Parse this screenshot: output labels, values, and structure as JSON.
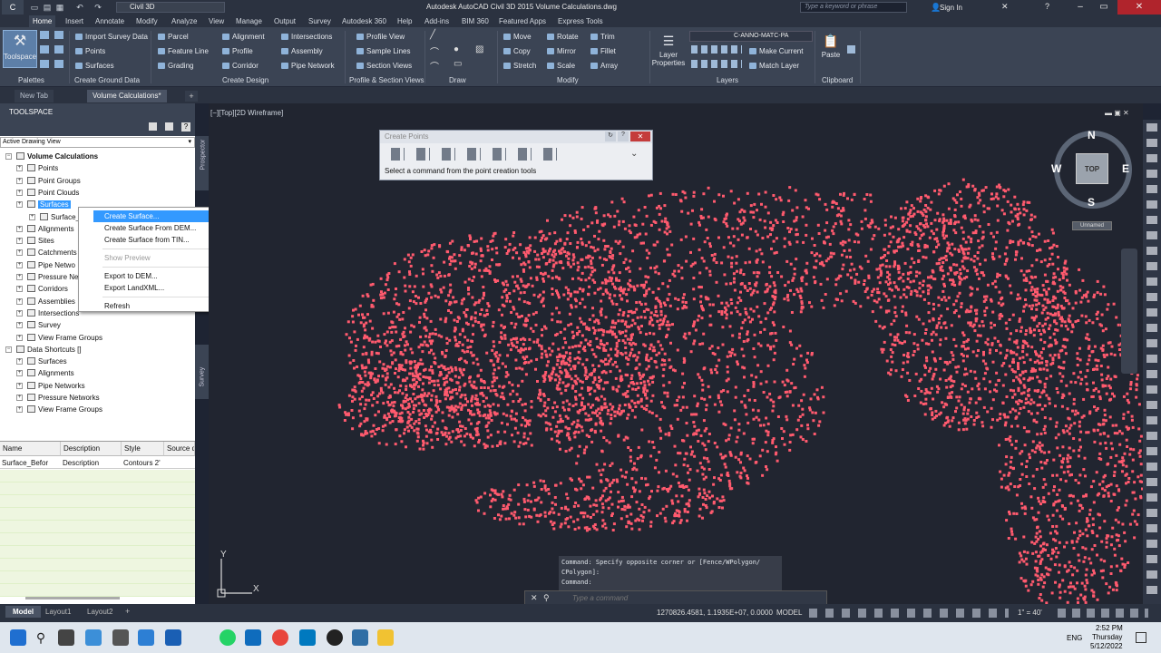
{
  "titlebar": {
    "title": "Autodesk AutoCAD Civil 3D 2015    Volume Calculations.dwg",
    "workspace": "Civil 3D",
    "search_placeholder": "Type a keyword or phrase",
    "sign_in": "Sign In"
  },
  "ribbon_tabs": [
    "Home",
    "Insert",
    "Annotate",
    "Modify",
    "Analyze",
    "View",
    "Manage",
    "Output",
    "Survey",
    "Autodesk 360",
    "Help",
    "Add-ins",
    "BIM 360",
    "Featured Apps",
    "Express Tools"
  ],
  "ribbon": {
    "toolspace_label": "Toolspace",
    "palettes_title": "Palettes",
    "create_ground_data": {
      "title": "Create Ground Data",
      "items": [
        "Import Survey Data",
        "Points",
        "Surfaces"
      ]
    },
    "create_design": {
      "title": "Create Design",
      "items": [
        "Parcel",
        "Feature Line",
        "Grading",
        "Alignment",
        "Profile",
        "Corridor",
        "Intersections",
        "Assembly",
        "Pipe Network"
      ]
    },
    "profile_section": {
      "title": "Profile & Section Views",
      "items": [
        "Profile View",
        "Sample Lines",
        "Section Views"
      ]
    },
    "draw_title": "Draw",
    "modify": {
      "title": "Modify",
      "items": [
        "Move",
        "Copy",
        "Stretch",
        "Rotate",
        "Mirror",
        "Scale",
        "Trim",
        "Fillet",
        "Array"
      ]
    },
    "layers": {
      "title": "Layers",
      "layer_properties": "Layer Properties",
      "current_layer": "C-ANNO-MATC-PA",
      "make_current": "Make Current",
      "match_layer": "Match Layer"
    },
    "clipboard": {
      "title": "Clipboard",
      "paste": "Paste"
    }
  },
  "doc_tabs": [
    "New Tab",
    "Volume Calculations*"
  ],
  "toolspace": {
    "header": "TOOLSPACE",
    "view_select": "Active Drawing View",
    "side_tabs": [
      "Prospector",
      "Survey"
    ],
    "tree": [
      {
        "label": "Volume Calculations",
        "level": 0,
        "bold": true
      },
      {
        "label": "Points",
        "level": 1
      },
      {
        "label": "Point Groups",
        "level": 1
      },
      {
        "label": "Point Clouds",
        "level": 1
      },
      {
        "label": "Surfaces",
        "level": 1,
        "selected": true
      },
      {
        "label": "Surface_",
        "level": 2
      },
      {
        "label": "Alignments",
        "level": 1
      },
      {
        "label": "Sites",
        "level": 1
      },
      {
        "label": "Catchments",
        "level": 1
      },
      {
        "label": "Pipe Netwo",
        "level": 1
      },
      {
        "label": "Pressure Ne",
        "level": 1
      },
      {
        "label": "Corridors",
        "level": 1
      },
      {
        "label": "Assemblies",
        "level": 1
      },
      {
        "label": "Intersections",
        "level": 1
      },
      {
        "label": "Survey",
        "level": 1
      },
      {
        "label": "View Frame Groups",
        "level": 1
      },
      {
        "label": "Data Shortcuts []",
        "level": 0
      },
      {
        "label": "Surfaces",
        "level": 1
      },
      {
        "label": "Alignments",
        "level": 1
      },
      {
        "label": "Pipe Networks",
        "level": 1
      },
      {
        "label": "Pressure Networks",
        "level": 1
      },
      {
        "label": "View Frame Groups",
        "level": 1
      }
    ],
    "grid": {
      "headers": [
        "Name",
        "Description",
        "Style",
        "Source d"
      ],
      "row": [
        "Surface_Befor",
        "Description",
        "Contours 2'",
        ""
      ]
    }
  },
  "context_menu": {
    "items": [
      "Create Surface...",
      "Create Surface From DEM...",
      "Create Surface from TIN...",
      "Show Preview",
      "Export to DEM...",
      "Export LandXML...",
      "Refresh"
    ]
  },
  "viewport": {
    "label": "[−][Top][2D Wireframe]",
    "compass": {
      "n": "N",
      "s": "S",
      "e": "E",
      "w": "W",
      "top": "TOP"
    },
    "ucs_name": "Unnamed",
    "axis_y": "Y",
    "axis_x": "X"
  },
  "create_points": {
    "title": "Create Points",
    "hint": "Select a command from the point creation tools"
  },
  "command": {
    "history_1": "Command: Specify opposite corner or [Fence/WPolygon/",
    "history_2": "CPolygon]:",
    "history_3": "Command:",
    "placeholder": "Type a command"
  },
  "status": {
    "layout_tabs": [
      "Model",
      "Layout1",
      "Layout2"
    ],
    "coords": "1270826.4581, 1.1935E+07, 0.0000",
    "model": "MODEL",
    "scale": "1\" = 40'"
  },
  "taskbar": {
    "time": "2:52 PM",
    "day": "Thursday",
    "date": "5/12/2022",
    "lang": "ENG"
  },
  "colors": {
    "point_cloud": "#ff5a6e",
    "selection": "#3399ff",
    "canvas": "#212530"
  }
}
